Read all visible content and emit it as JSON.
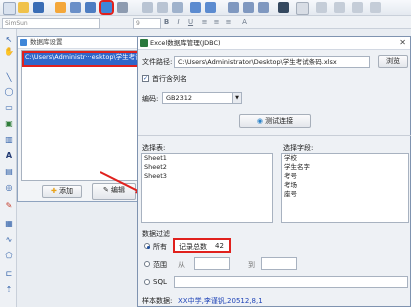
{
  "toolbar": {
    "font_name": "SimSun",
    "font_size": "9"
  },
  "data_source_dialog": {
    "title": "数据库设置",
    "items": [
      "C:\\Users\\Administr···esktop\\学生考试"
    ],
    "add_label": "添加",
    "edit_label": "编辑"
  },
  "excel_dialog": {
    "title": "Excel数据库管理(JDBC)",
    "file_path_label": "文件路径:",
    "file_path_value": "C:\\Users\\Administrator\\Desktop\\学生考试条码.xlsx",
    "browse_label": "浏览",
    "first_row_label": "首行含列名",
    "encoding_label": "编码:",
    "encoding_value": "GB2312",
    "test_label": "测试连接",
    "table_section_label": "选择表:",
    "tables": [
      "Sheet1",
      "Sheet2",
      "Sheet3"
    ],
    "field_section_label": "选择字段:",
    "fields": [
      "学校",
      "学生名字",
      "考号",
      "考场",
      "座号"
    ],
    "filter_label": "数据过滤",
    "filter_all_label": "所有",
    "record_total_label": "记录总数",
    "record_total_value": "42",
    "range_label": "范围",
    "from_label": "从",
    "to_label": "到",
    "sql_label": "SQL",
    "sample_label": "样本数据:",
    "sample_value": "XX中学,李谨钒,20512,8,1"
  },
  "colors": {
    "accent": "#e0211d",
    "selection": "#2f66c9"
  }
}
